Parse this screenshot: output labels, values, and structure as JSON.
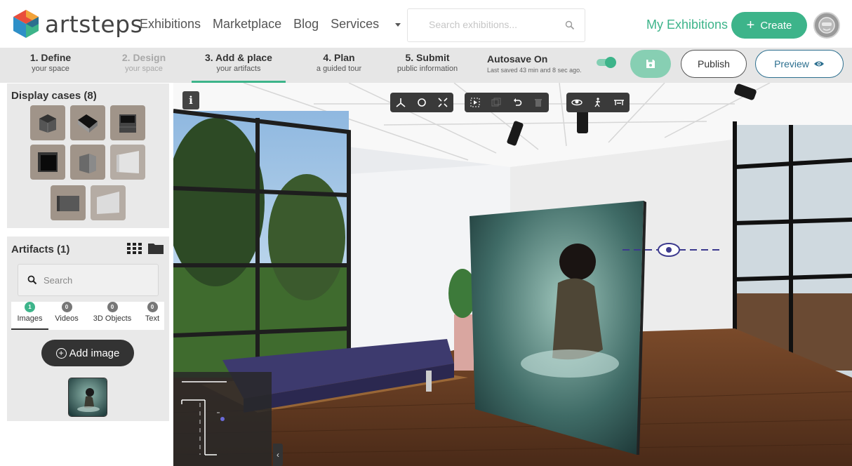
{
  "brand": {
    "name": "artsteps"
  },
  "nav": {
    "links": [
      "Exhibitions",
      "Marketplace",
      "Blog",
      "Services"
    ],
    "search_placeholder": "Search exhibitions...",
    "my_exhibitions": "My Exhibitions",
    "create_label": "Create"
  },
  "steps": [
    {
      "title": "1. Define",
      "subtitle": "your space"
    },
    {
      "title": "2. Design",
      "subtitle": "your space"
    },
    {
      "title": "3. Add & place",
      "subtitle": "your artifacts"
    },
    {
      "title": "4. Plan",
      "subtitle": "a guided tour"
    },
    {
      "title": "5. Submit",
      "subtitle": "public information"
    }
  ],
  "autosave": {
    "title": "Autosave On",
    "detail": "Last saved 43 min and 8 sec ago.",
    "enabled": true
  },
  "actions": {
    "publish": "Publish",
    "preview": "Preview"
  },
  "display_cases": {
    "title": "Display cases (8)"
  },
  "artifacts": {
    "title": "Artifacts (1)",
    "search_placeholder": "Search",
    "tabs": [
      {
        "count": "1",
        "label": "Images"
      },
      {
        "count": "0",
        "label": "Videos"
      },
      {
        "count": "0",
        "label": "3D Objects"
      },
      {
        "count": "0",
        "label": "Text"
      }
    ],
    "add_image": "Add image"
  },
  "viewer": {
    "info_label": "i",
    "collapse_label": "‹"
  },
  "colors": {
    "accent": "#3db48a",
    "preview": "#2c6f8f",
    "dark": "#333333"
  }
}
